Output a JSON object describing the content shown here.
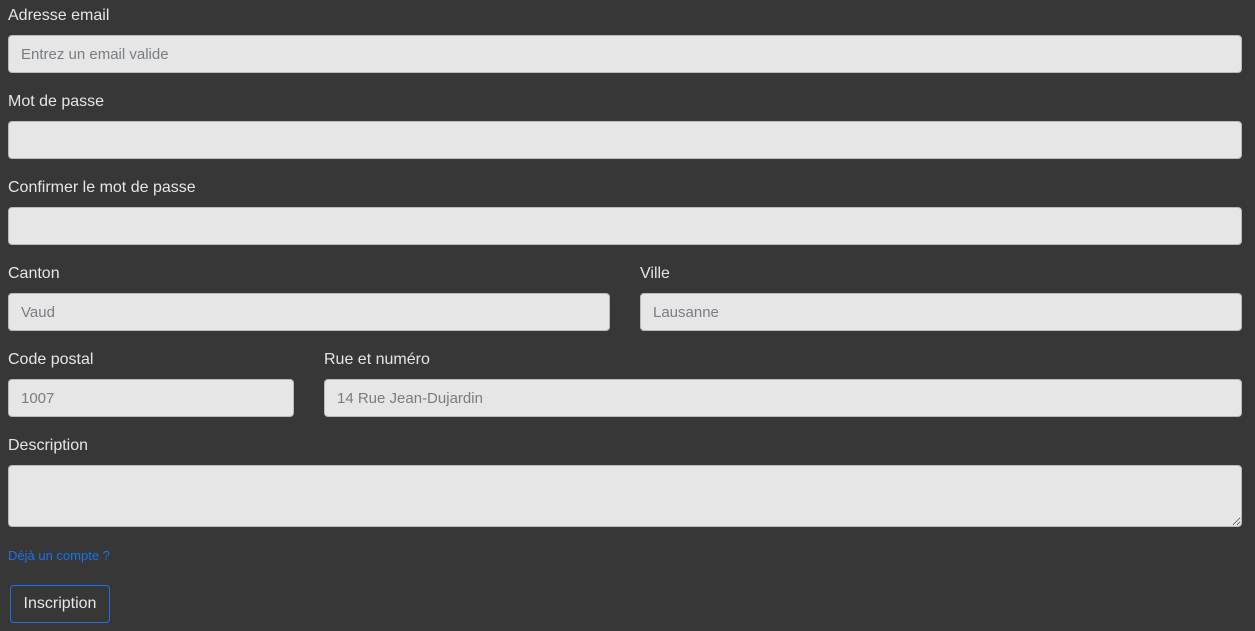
{
  "form": {
    "email": {
      "label": "Adresse email",
      "placeholder": "Entrez un email valide",
      "value": ""
    },
    "password": {
      "label": "Mot de passe",
      "value": ""
    },
    "confirm_password": {
      "label": "Confirmer le mot de passe",
      "value": ""
    },
    "canton": {
      "label": "Canton",
      "placeholder": "Vaud"
    },
    "city": {
      "label": "Ville",
      "placeholder": "Lausanne"
    },
    "postal_code": {
      "label": "Code postal",
      "placeholder": "1007"
    },
    "street": {
      "label": "Rue et numéro",
      "placeholder": "14 Rue Jean-Dujardin"
    },
    "description": {
      "label": "Description",
      "value": ""
    },
    "login_link": "Déjà un compte ?",
    "submit_label": "Inscription"
  },
  "colors": {
    "background": "#373737",
    "input_background": "#e6e6e6",
    "link": "#1a73e8",
    "button_border": "#1f6fe0"
  }
}
